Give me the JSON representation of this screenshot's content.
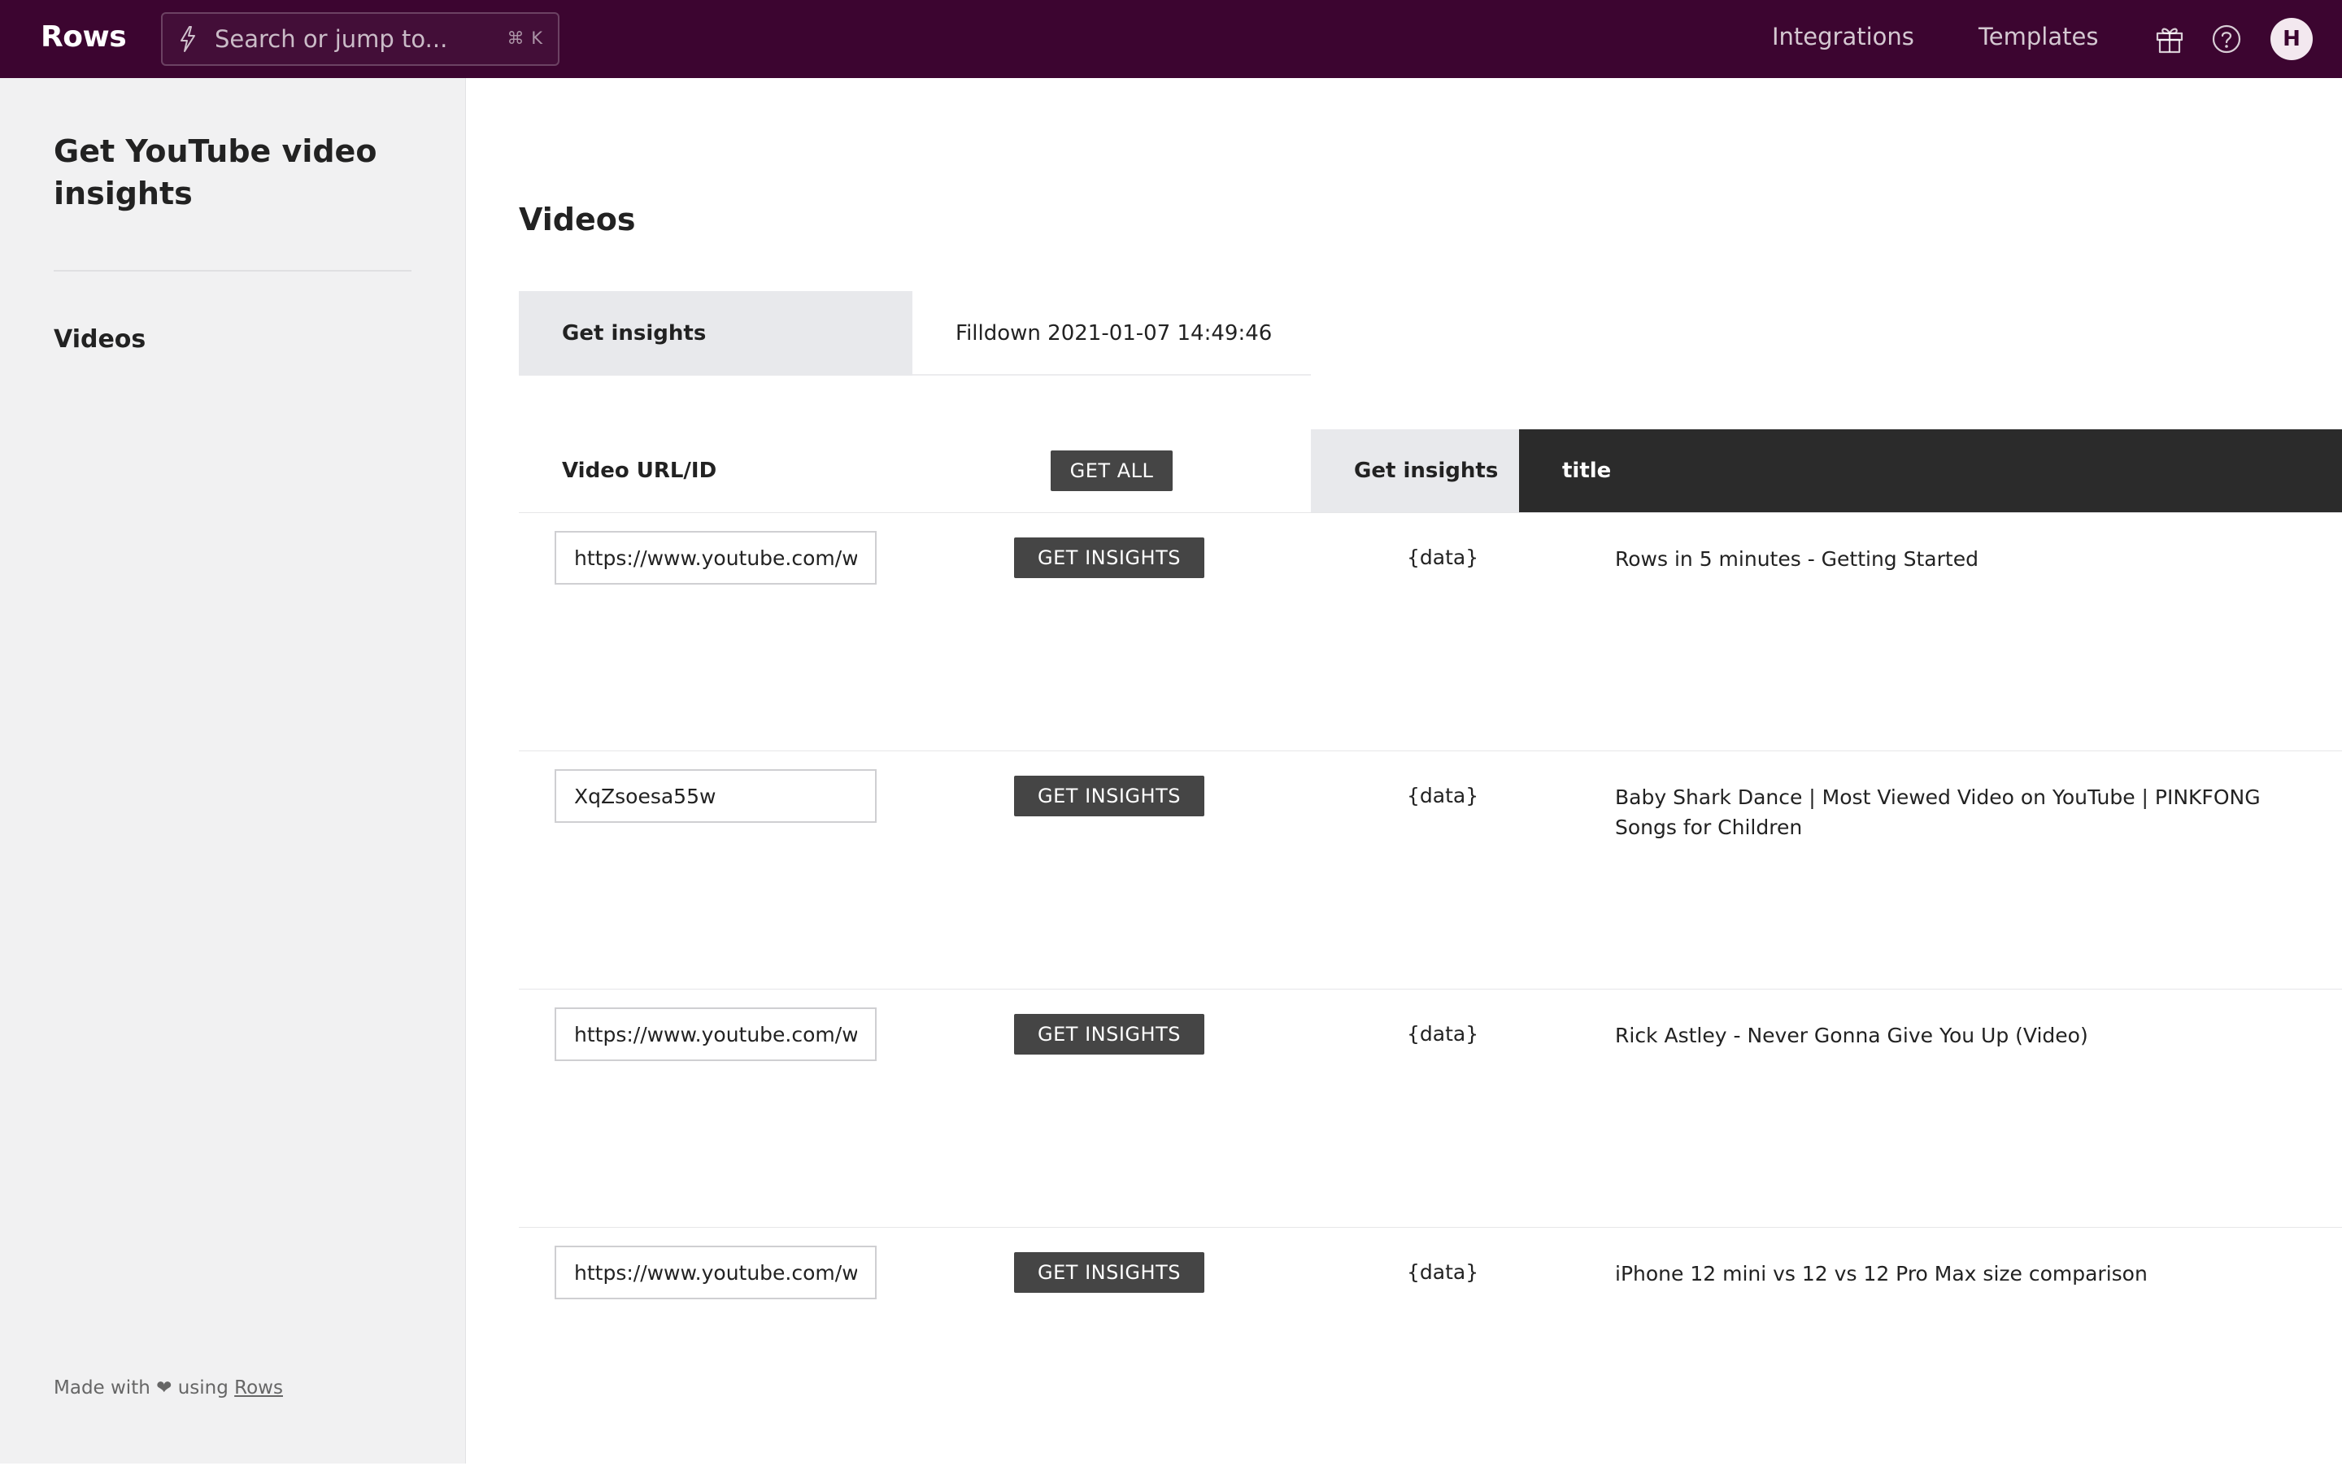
{
  "topbar": {
    "logo": "Rows",
    "search_placeholder": "Search or jump to...",
    "search_shortcut": "⌘ K",
    "nav": [
      "Integrations",
      "Templates"
    ],
    "icons": [
      "gift-icon",
      "help-icon"
    ],
    "avatar_initial": "H",
    "background_color": "#3c0530"
  },
  "sidebar": {
    "title": "Get YouTube video insights",
    "items": [
      {
        "label": "Videos"
      }
    ],
    "footer": {
      "prefix": "Made with ❤ using ",
      "link": "Rows"
    }
  },
  "main": {
    "section_title": "Videos",
    "action": {
      "label": "Get insights",
      "value": "Filldown 2021-01-07 14:49:46"
    },
    "table": {
      "headers": {
        "url": "Video URL/ID",
        "get_all": "GET ALL",
        "insights": "Get insights",
        "title": "title"
      },
      "button_label": "GET INSIGHTS",
      "rows": [
        {
          "url": "https://www.youtube.com/watch?v=",
          "data": "{data}",
          "title": "Rows in 5 minutes - Getting Started"
        },
        {
          "url": "XqZsoesa55w",
          "data": "{data}",
          "title": "Baby Shark Dance | Most Viewed Video on YouTube | PINKFONG Songs for Children"
        },
        {
          "url": "https://www.youtube.com/watch?v=",
          "data": "{data}",
          "title": "Rick Astley - Never Gonna Give You Up (Video)"
        },
        {
          "url": "https://www.youtube.com/watch?v=",
          "data": "{data}",
          "title": "iPhone 12 mini vs 12 vs 12 Pro Max size comparison"
        }
      ]
    }
  }
}
